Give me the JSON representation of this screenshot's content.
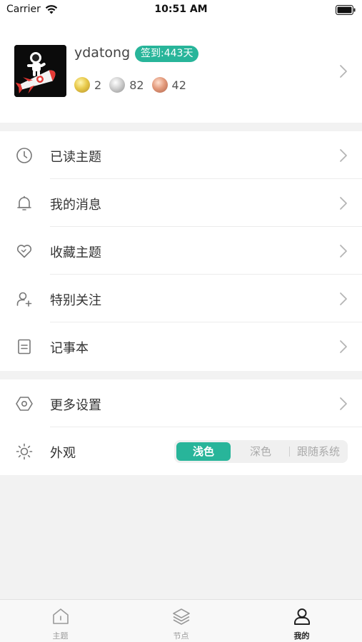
{
  "status_bar": {
    "carrier": "Carrier",
    "time": "10:51 AM"
  },
  "profile": {
    "username": "ydatong",
    "checkin_badge": "签到:443天",
    "coins": {
      "gold": "2",
      "silver": "82",
      "bronze": "42"
    }
  },
  "menu_group_1": [
    {
      "label": "已读主题",
      "icon": "clock-icon"
    },
    {
      "label": "我的消息",
      "icon": "bell-icon"
    },
    {
      "label": "收藏主题",
      "icon": "heart-icon"
    },
    {
      "label": "特别关注",
      "icon": "user-add-icon"
    },
    {
      "label": "记事本",
      "icon": "notepad-icon"
    }
  ],
  "menu_group_2": {
    "more_settings": {
      "label": "更多设置",
      "icon": "hexagon-settings-icon"
    },
    "appearance": {
      "label": "外观",
      "icon": "sun-icon",
      "options": [
        "浅色",
        "深色",
        "跟随系统"
      ],
      "selected": "浅色"
    }
  },
  "tab_bar": {
    "tabs": [
      {
        "label": "主题",
        "icon": "home-icon"
      },
      {
        "label": "节点",
        "icon": "layers-icon"
      },
      {
        "label": "我的",
        "icon": "person-icon"
      }
    ],
    "active": "我的"
  },
  "colors": {
    "accent": "#28b59a",
    "background": "#f2f2f2"
  }
}
